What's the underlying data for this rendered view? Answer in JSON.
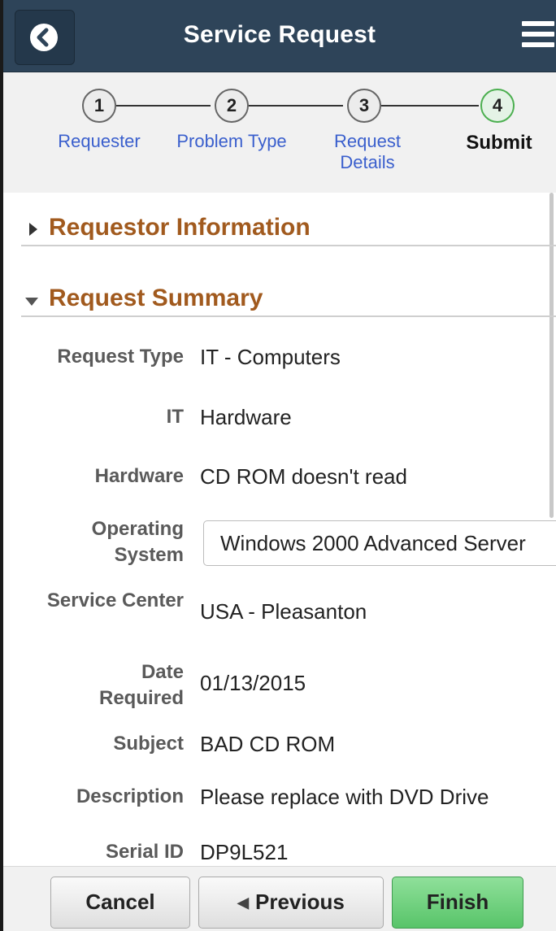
{
  "header": {
    "title": "Service Request",
    "back_icon": "chevron-left-icon",
    "menu_icon": "hamburger-menu-icon"
  },
  "steps": [
    {
      "number": "1",
      "label": "Requester"
    },
    {
      "number": "2",
      "label": "Problem Type"
    },
    {
      "number": "3",
      "label": "Request Details"
    },
    {
      "number": "4",
      "label": "Submit"
    }
  ],
  "sections": {
    "requestor": {
      "title": "Requestor Information",
      "expanded": false
    },
    "summary": {
      "title": "Request Summary",
      "expanded": true
    }
  },
  "fields": {
    "request_type": {
      "label": "Request Type",
      "value": "IT - Computers"
    },
    "it": {
      "label": "IT",
      "value": "Hardware"
    },
    "hardware": {
      "label": "Hardware",
      "value": "CD ROM doesn't read"
    },
    "operating_system": {
      "label": "Operating System",
      "value": "Windows 2000 Advanced Server"
    },
    "service_center": {
      "label": "Service Center",
      "value": "USA - Pleasanton"
    },
    "date_required": {
      "label": "Date Required",
      "value": "01/13/2015"
    },
    "subject": {
      "label": "Subject",
      "value": "BAD CD ROM"
    },
    "description": {
      "label": "Description",
      "value": "Please replace with DVD Drive"
    },
    "serial_id": {
      "label": "Serial ID",
      "value": "DP9L521"
    }
  },
  "footer": {
    "cancel": "Cancel",
    "previous": "Previous",
    "finish": "Finish"
  },
  "colors": {
    "header_bg": "#2e4459",
    "section_title": "#a15a1e",
    "step_link": "#3a5fcd",
    "active_step": "#4caf50",
    "finish_button": "#58c469"
  }
}
